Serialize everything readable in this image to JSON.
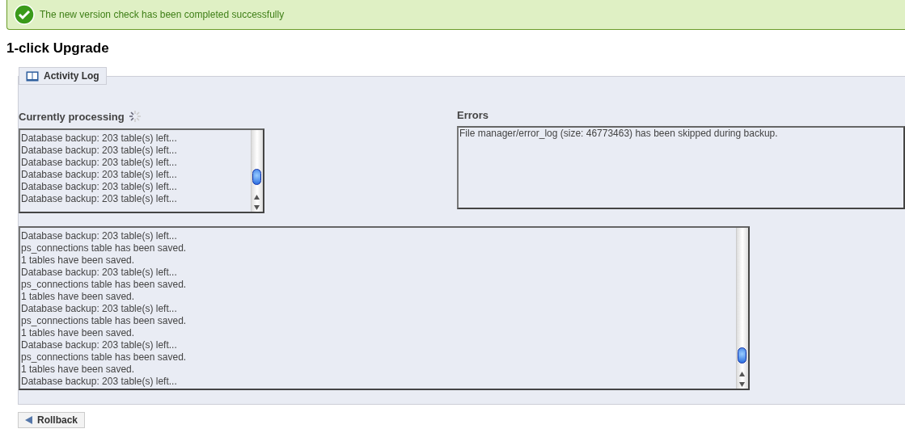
{
  "notice": {
    "kind": "success",
    "text": "The new version check has been completed successfully"
  },
  "page_title": "1-click Upgrade",
  "panel": {
    "legend": "Activity Log",
    "processing": {
      "label": "Currently processing",
      "lines": [
        "Database backup: 203 table(s) left...",
        "Database backup: 203 table(s) left...",
        "Database backup: 203 table(s) left...",
        "Database backup: 203 table(s) left...",
        "Database backup: 203 table(s) left...",
        "Database backup: 203 table(s) left..."
      ]
    },
    "errors": {
      "label": "Errors",
      "lines": [
        "File manager/error_log (size: 46773463) has been skipped during backup."
      ]
    },
    "log": [
      "Database backup: 203 table(s) left...",
      "ps_connections table has been saved.",
      "1 tables have been saved.",
      "Database backup: 203 table(s) left...",
      "ps_connections table has been saved.",
      "1 tables have been saved.",
      "Database backup: 203 table(s) left...",
      "ps_connections table has been saved.",
      "1 tables have been saved.",
      "Database backup: 203 table(s) left...",
      "ps_connections table has been saved.",
      "1 tables have been saved.",
      "Database backup: 203 table(s) left..."
    ]
  },
  "rollback_button": "Rollback"
}
